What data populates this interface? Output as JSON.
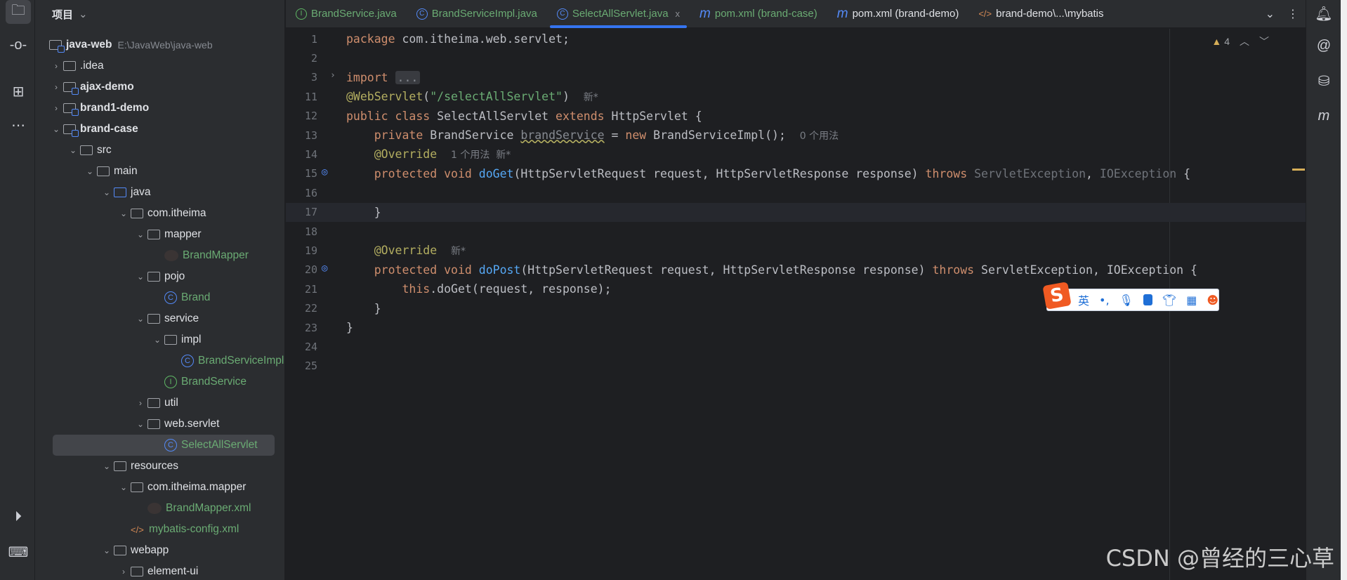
{
  "sidebar": {
    "title": "项目",
    "tree": [
      {
        "label": "java-web",
        "path": "E:\\JavaWeb\\java-web",
        "depth": 0,
        "arrow": "",
        "icon": "module",
        "bold": true
      },
      {
        "label": ".idea",
        "depth": 1,
        "arrow": "›",
        "icon": "folder"
      },
      {
        "label": "ajax-demo",
        "depth": 1,
        "arrow": "›",
        "icon": "module",
        "bold": true
      },
      {
        "label": "brand1-demo",
        "depth": 1,
        "arrow": "›",
        "icon": "module",
        "bold": true
      },
      {
        "label": "brand-case",
        "depth": 1,
        "arrow": "⌄",
        "icon": "module",
        "bold": true
      },
      {
        "label": "src",
        "depth": 2,
        "arrow": "⌄",
        "icon": "folder"
      },
      {
        "label": "main",
        "depth": 3,
        "arrow": "⌄",
        "icon": "folder"
      },
      {
        "label": "java",
        "depth": 4,
        "arrow": "⌄",
        "icon": "source-folder"
      },
      {
        "label": "com.itheima",
        "depth": 5,
        "arrow": "⌄",
        "icon": "package"
      },
      {
        "label": "mapper",
        "depth": 6,
        "arrow": "⌄",
        "icon": "package"
      },
      {
        "label": "BrandMapper",
        "depth": 7,
        "arrow": "",
        "icon": "mybatis",
        "green": true
      },
      {
        "label": "pojo",
        "depth": 6,
        "arrow": "⌄",
        "icon": "package"
      },
      {
        "label": "Brand",
        "depth": 7,
        "arrow": "",
        "icon": "class",
        "green": true
      },
      {
        "label": "service",
        "depth": 6,
        "arrow": "⌄",
        "icon": "package"
      },
      {
        "label": "impl",
        "depth": 7,
        "arrow": "⌄",
        "icon": "package"
      },
      {
        "label": "BrandServiceImpl",
        "depth": 8,
        "arrow": "",
        "icon": "class",
        "green": true
      },
      {
        "label": "BrandService",
        "depth": 7,
        "arrow": "",
        "icon": "interface",
        "green": true
      },
      {
        "label": "util",
        "depth": 6,
        "arrow": "›",
        "icon": "package"
      },
      {
        "label": "web.servlet",
        "depth": 6,
        "arrow": "⌄",
        "icon": "package"
      },
      {
        "label": "SelectAllServlet",
        "depth": 7,
        "arrow": "",
        "icon": "class",
        "green": true,
        "selected": true
      },
      {
        "label": "resources",
        "depth": 4,
        "arrow": "⌄",
        "icon": "resources-folder"
      },
      {
        "label": "com.itheima.mapper",
        "depth": 5,
        "arrow": "⌄",
        "icon": "folder"
      },
      {
        "label": "BrandMapper.xml",
        "depth": 6,
        "arrow": "",
        "icon": "mybatis-xml",
        "green": true
      },
      {
        "label": "mybatis-config.xml",
        "depth": 5,
        "arrow": "",
        "icon": "xml",
        "green": true
      },
      {
        "label": "webapp",
        "depth": 4,
        "arrow": "⌄",
        "icon": "web-folder"
      },
      {
        "label": "element-ui",
        "depth": 5,
        "arrow": "›",
        "icon": "folder"
      }
    ]
  },
  "tabs": [
    {
      "label": "BrandService.java",
      "icon": "interface",
      "color": "#6aab73"
    },
    {
      "label": "BrandServiceImpl.java",
      "icon": "class",
      "color": "#6aab73"
    },
    {
      "label": "SelectAllServlet.java",
      "icon": "class",
      "color": "#6aab73",
      "active": true,
      "close": "x"
    },
    {
      "label": "pom.xml (brand-case)",
      "icon": "maven",
      "color": "#6aab73"
    },
    {
      "label": "pom.xml (brand-demo)",
      "icon": "maven",
      "color": "#dfe1e5"
    },
    {
      "label": "brand-demo\\...\\mybatis",
      "icon": "xml",
      "color": "#dfe1e5"
    }
  ],
  "inspection": {
    "warnings": "4"
  },
  "code": [
    {
      "n": "1",
      "t": [
        [
          "kw",
          "package "
        ],
        [
          "",
          "com.itheima.web.servlet;"
        ]
      ]
    },
    {
      "n": "2",
      "t": []
    },
    {
      "n": "3",
      "fold": true,
      "t": [
        [
          "kw",
          "import "
        ],
        [
          "fold",
          "..."
        ]
      ]
    },
    {
      "n": "11",
      "t": [
        [
          "ann",
          "@WebServlet"
        ],
        [
          "",
          "("
        ],
        [
          "str",
          "\"/selectAllServlet\""
        ],
        [
          "",
          ")  "
        ],
        [
          "cm",
          "新*"
        ]
      ]
    },
    {
      "n": "12",
      "t": [
        [
          "kw",
          "public class "
        ],
        [
          "",
          "SelectAllServlet "
        ],
        [
          "kw",
          "extends "
        ],
        [
          "",
          "HttpServlet {"
        ]
      ]
    },
    {
      "n": "13",
      "t": [
        [
          "",
          "    "
        ],
        [
          "kw",
          "private "
        ],
        [
          "",
          "BrandService "
        ],
        [
          "ul",
          "brandService"
        ],
        [
          "",
          " = "
        ],
        [
          "kw",
          "new "
        ],
        [
          "",
          "BrandServiceImpl();  "
        ],
        [
          "cm",
          "0 个用法"
        ]
      ]
    },
    {
      "n": "14",
      "t": [
        [
          "",
          "    "
        ],
        [
          "ann",
          "@Override"
        ],
        [
          "",
          "  "
        ],
        [
          "cm",
          "1 个用法  新*"
        ]
      ]
    },
    {
      "n": "15",
      "mark": true,
      "t": [
        [
          "",
          "    "
        ],
        [
          "kw",
          "protected void "
        ],
        [
          "fn",
          "doGet"
        ],
        [
          "",
          "(HttpServletRequest request, HttpServletResponse response) "
        ],
        [
          "kw",
          "throws "
        ],
        [
          "gr",
          "ServletException"
        ],
        [
          "",
          ", "
        ],
        [
          "gr",
          "IOException"
        ],
        [
          "",
          " {"
        ]
      ]
    },
    {
      "n": "16",
      "t": []
    },
    {
      "n": "17",
      "cur": true,
      "t": [
        [
          "",
          "    }"
        ]
      ]
    },
    {
      "n": "18",
      "t": []
    },
    {
      "n": "19",
      "t": [
        [
          "",
          "    "
        ],
        [
          "ann",
          "@Override"
        ],
        [
          "",
          "  "
        ],
        [
          "cm",
          "新*"
        ]
      ]
    },
    {
      "n": "20",
      "mark": true,
      "t": [
        [
          "",
          "    "
        ],
        [
          "kw",
          "protected void "
        ],
        [
          "fn",
          "doPost"
        ],
        [
          "",
          "(HttpServletRequest request, HttpServletResponse response) "
        ],
        [
          "kw",
          "throws "
        ],
        [
          "",
          "ServletException, IOException {"
        ]
      ]
    },
    {
      "n": "21",
      "t": [
        [
          "",
          "        "
        ],
        [
          "kw",
          "this"
        ],
        [
          "",
          ".doGet(request, response);"
        ]
      ]
    },
    {
      "n": "22",
      "t": [
        [
          "",
          "    }"
        ]
      ]
    },
    {
      "n": "23",
      "t": [
        [
          "",
          "}"
        ]
      ]
    },
    {
      "n": "24",
      "t": []
    },
    {
      "n": "25",
      "t": []
    }
  ],
  "ime": {
    "mode": "英",
    "punct": "•,"
  },
  "watermark": "CSDN @曾经的三心草",
  "colors": {
    "accent": "#3574f0",
    "keyword": "#cf8e6d",
    "annotation": "#b3ae60",
    "string": "#6aab73",
    "function": "#56a8f5"
  }
}
